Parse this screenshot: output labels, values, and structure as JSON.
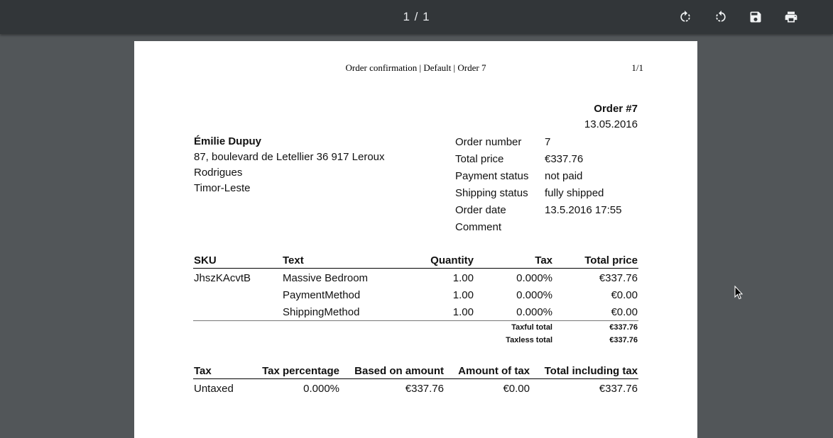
{
  "toolbar": {
    "page_indicator": "1 / 1",
    "icons": [
      "rotate-clockwise-icon",
      "rotate-counterclockwise-icon",
      "save-icon",
      "print-icon"
    ]
  },
  "document": {
    "header_title": "Order confirmation | Default | Order 7",
    "header_page": "1/1",
    "order_title": "Order #7",
    "order_date_top": "13.05.2016",
    "customer": {
      "name": "Émilie Dupuy",
      "address_line1": "87, boulevard de Letellier 36 917 Leroux",
      "address_line2": "Rodrigues",
      "address_line3": "Timor-Leste"
    },
    "info": [
      {
        "label": "Order number",
        "value": "7"
      },
      {
        "label": "Total price",
        "value": "€337.76"
      },
      {
        "label": "Payment status",
        "value": "not paid"
      },
      {
        "label": "Shipping status",
        "value": "fully shipped"
      },
      {
        "label": "Order date",
        "value": "13.5.2016 17:55"
      },
      {
        "label": "Comment",
        "value": ""
      }
    ],
    "items_table": {
      "headers": {
        "sku": "SKU",
        "text": "Text",
        "quantity": "Quantity",
        "tax": "Tax",
        "total": "Total price"
      },
      "rows": [
        {
          "sku": "JhszKAcvtB",
          "text": "Massive Bedroom",
          "quantity": "1.00",
          "tax": "0.000%",
          "total": "€337.76"
        },
        {
          "sku": "",
          "text": "PaymentMethod",
          "quantity": "1.00",
          "tax": "0.000%",
          "total": "€0.00"
        },
        {
          "sku": "",
          "text": "ShippingMethod",
          "quantity": "1.00",
          "tax": "0.000%",
          "total": "€0.00"
        }
      ],
      "taxful_label": "Taxful total",
      "taxful_value": "€337.76",
      "taxless_label": "Taxless total",
      "taxless_value": "€337.76"
    },
    "tax_table": {
      "headers": {
        "tax": "Tax",
        "percentage": "Tax percentage",
        "based": "Based on amount",
        "amount": "Amount of tax",
        "total": "Total including tax"
      },
      "rows": [
        {
          "tax": "Untaxed",
          "percentage": "0.000%",
          "based": "€337.76",
          "amount": "€0.00",
          "total": "€337.76"
        }
      ]
    }
  }
}
